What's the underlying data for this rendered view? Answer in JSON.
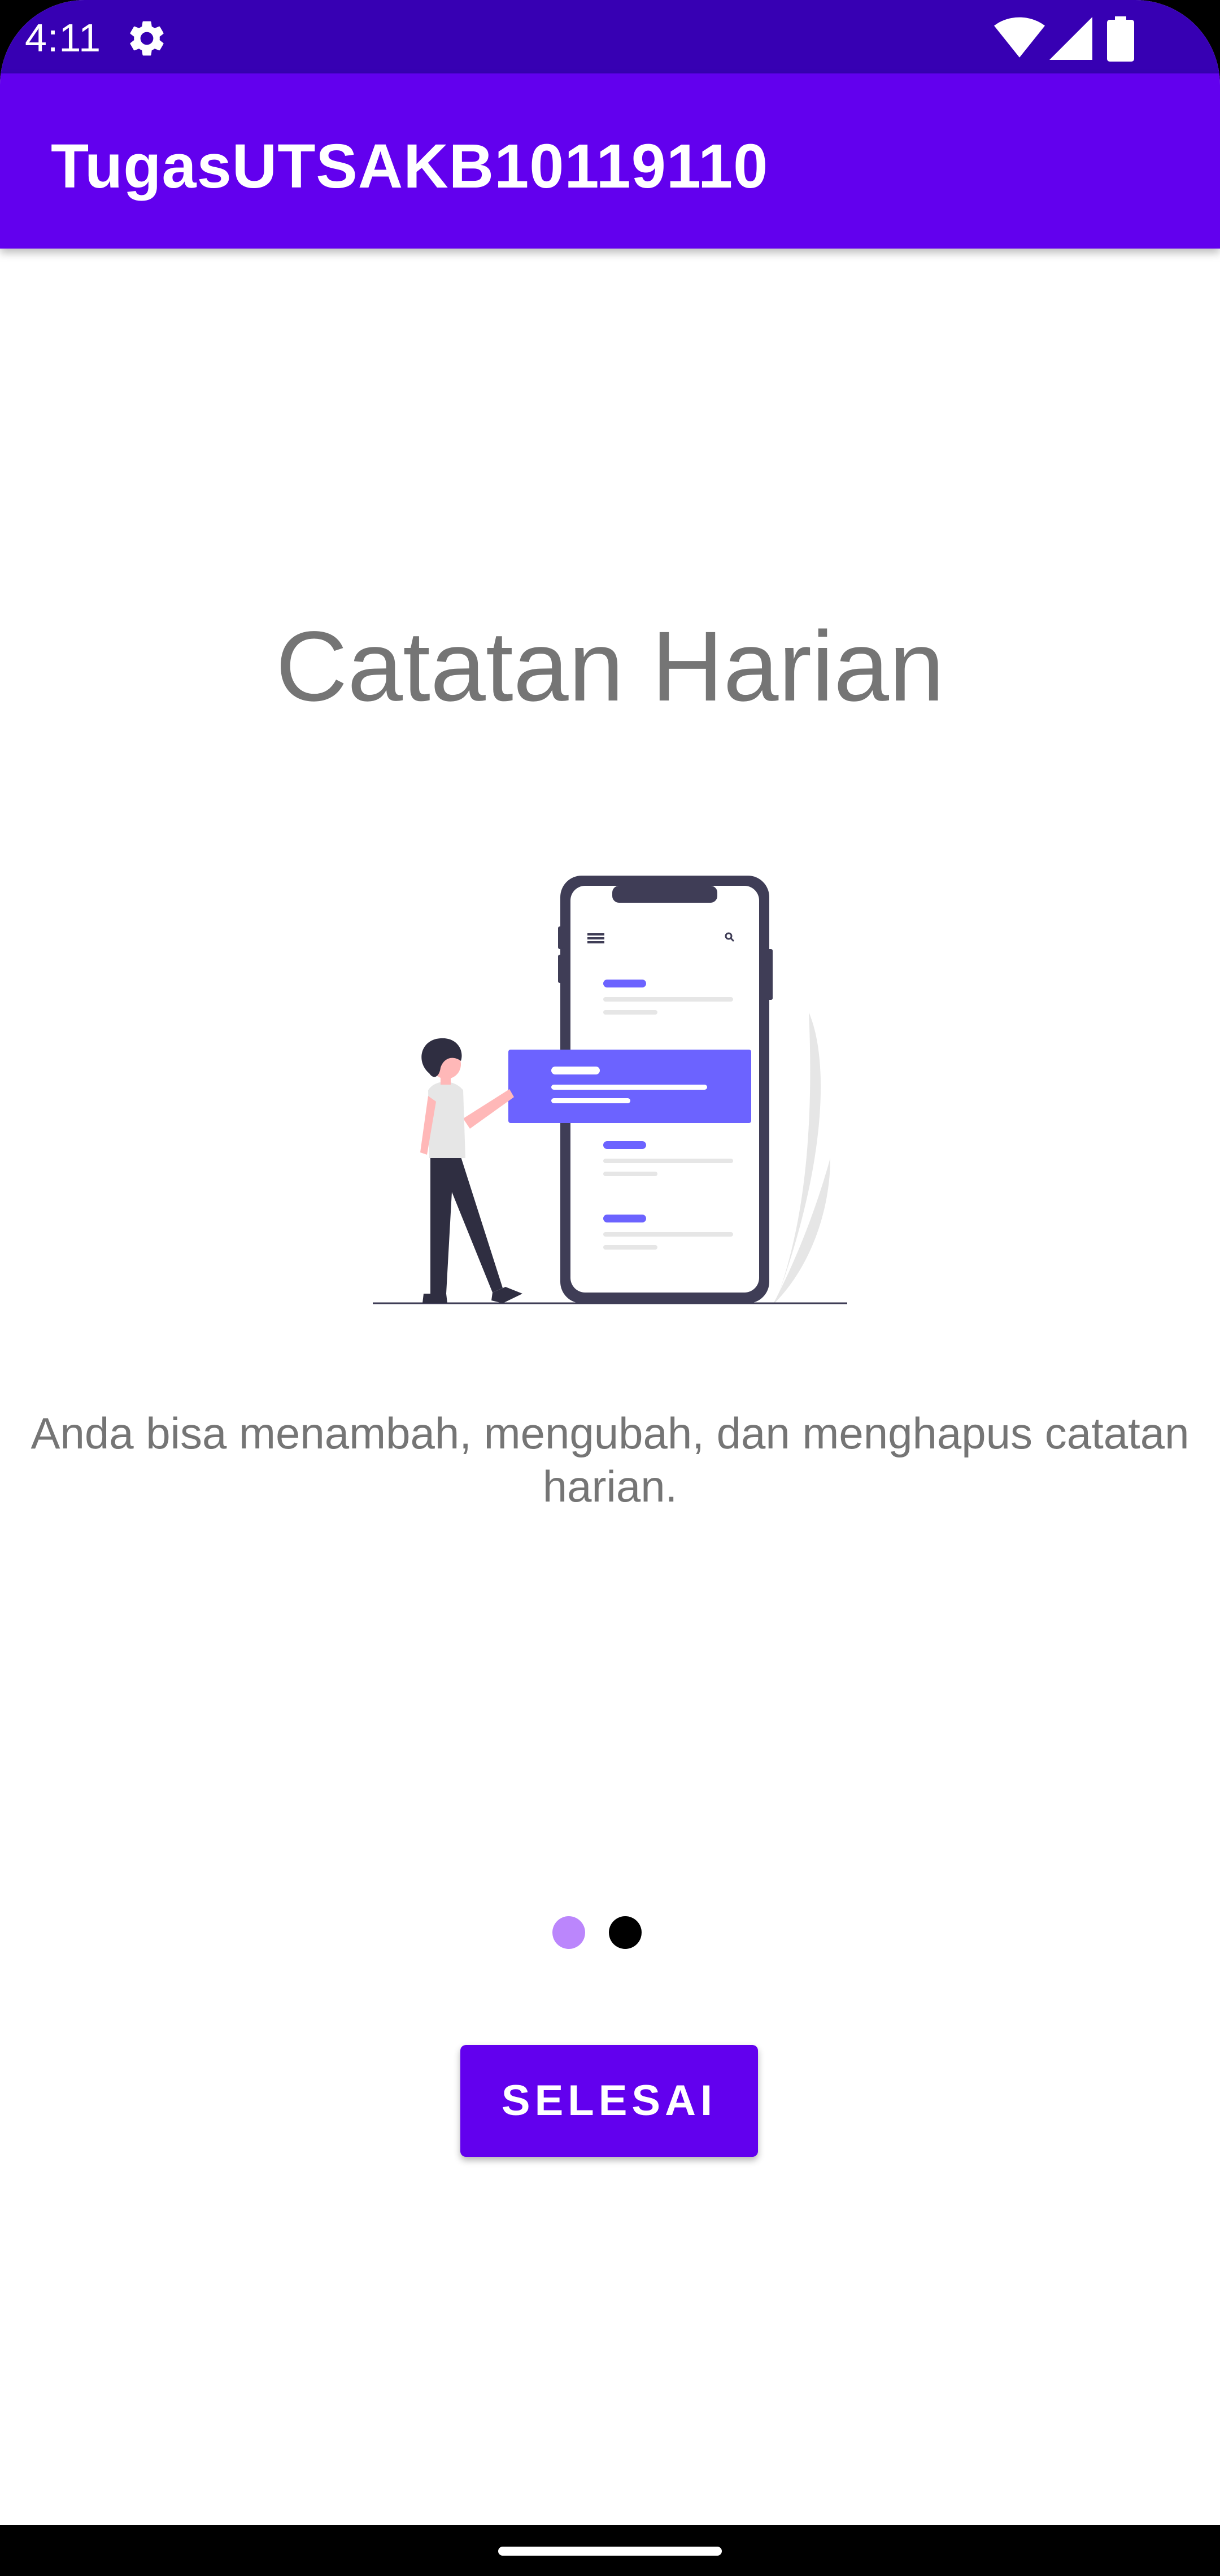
{
  "status_bar": {
    "time": "4:11",
    "icons": [
      "settings-icon",
      "wifi-icon",
      "signal-icon",
      "battery-icon"
    ],
    "background": "#3700B3"
  },
  "app_bar": {
    "title": "TugasUTSAKB10119110",
    "background": "#6200EE"
  },
  "onboarding": {
    "heading": "Catatan Harian",
    "illustration": "person-with-phone-notes-illustration",
    "description": "Anda bisa menambah, mengubah, dan menghapus catatan harian.",
    "page_indicator": {
      "total": 2,
      "current": 2,
      "inactive_color": "#BB86FC",
      "active_color": "#000000"
    },
    "finish_button_label": "SELESAI"
  },
  "colors": {
    "accent": "#6200EE",
    "illustration_accent": "#6C63FF",
    "text_secondary": "#757575"
  }
}
